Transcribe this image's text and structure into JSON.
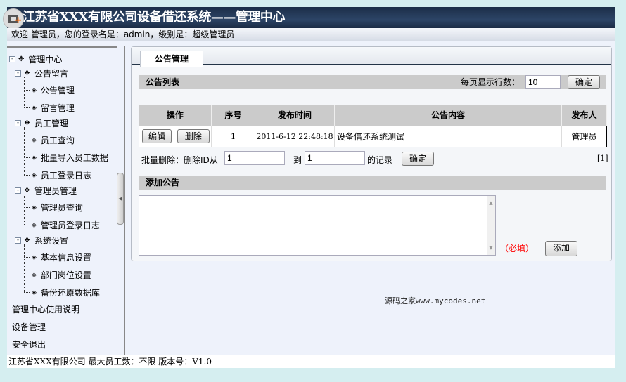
{
  "header": {
    "title": "江苏省XXX有限公司设备借还系统——管理中心",
    "welcome": "欢迎 管理员，您的登录名是：admin，级别是：超级管理员"
  },
  "sidebar": {
    "root": "管理中心",
    "groups": [
      {
        "label": "公告留言",
        "items": [
          "公告管理",
          "留言管理"
        ]
      },
      {
        "label": "员工管理",
        "items": [
          "员工查询",
          "批量导入员工数据",
          "员工登录日志"
        ]
      },
      {
        "label": "管理员管理",
        "items": [
          "管理员查询",
          "管理员登录日志"
        ]
      },
      {
        "label": "系统设置",
        "items": [
          "基本信息设置",
          "部门岗位设置",
          "备份还原数据库"
        ]
      }
    ],
    "links": [
      "管理中心使用说明",
      "设备管理",
      "安全退出"
    ]
  },
  "main": {
    "tab": "公告管理",
    "list_title": "公告列表",
    "rows_per_page_label": "每页显示行数：",
    "rows_per_page": "10",
    "confirm": "确定",
    "columns": [
      "操作",
      "序号",
      "发布时间",
      "公告内容",
      "发布人"
    ],
    "rows": [
      {
        "edit": "编辑",
        "delete": "删除",
        "id": "1",
        "time": "2011-6-12 22:48:18",
        "content": "设备借还系统测试",
        "author": "管理员"
      }
    ],
    "batch_label": "批量删除：删除ID从",
    "batch_from": "1",
    "batch_to_label": "到",
    "batch_to": "1",
    "batch_suffix": "的记录",
    "batch_confirm": "确定",
    "pager": "[1]",
    "add_title": "添加公告",
    "required": "（必填）",
    "add_button": "添加"
  },
  "watermark": "源码之家www.mycodes.net",
  "footer": "江苏省XXX有限公司 最大员工数：不限 版本号：V1.0"
}
